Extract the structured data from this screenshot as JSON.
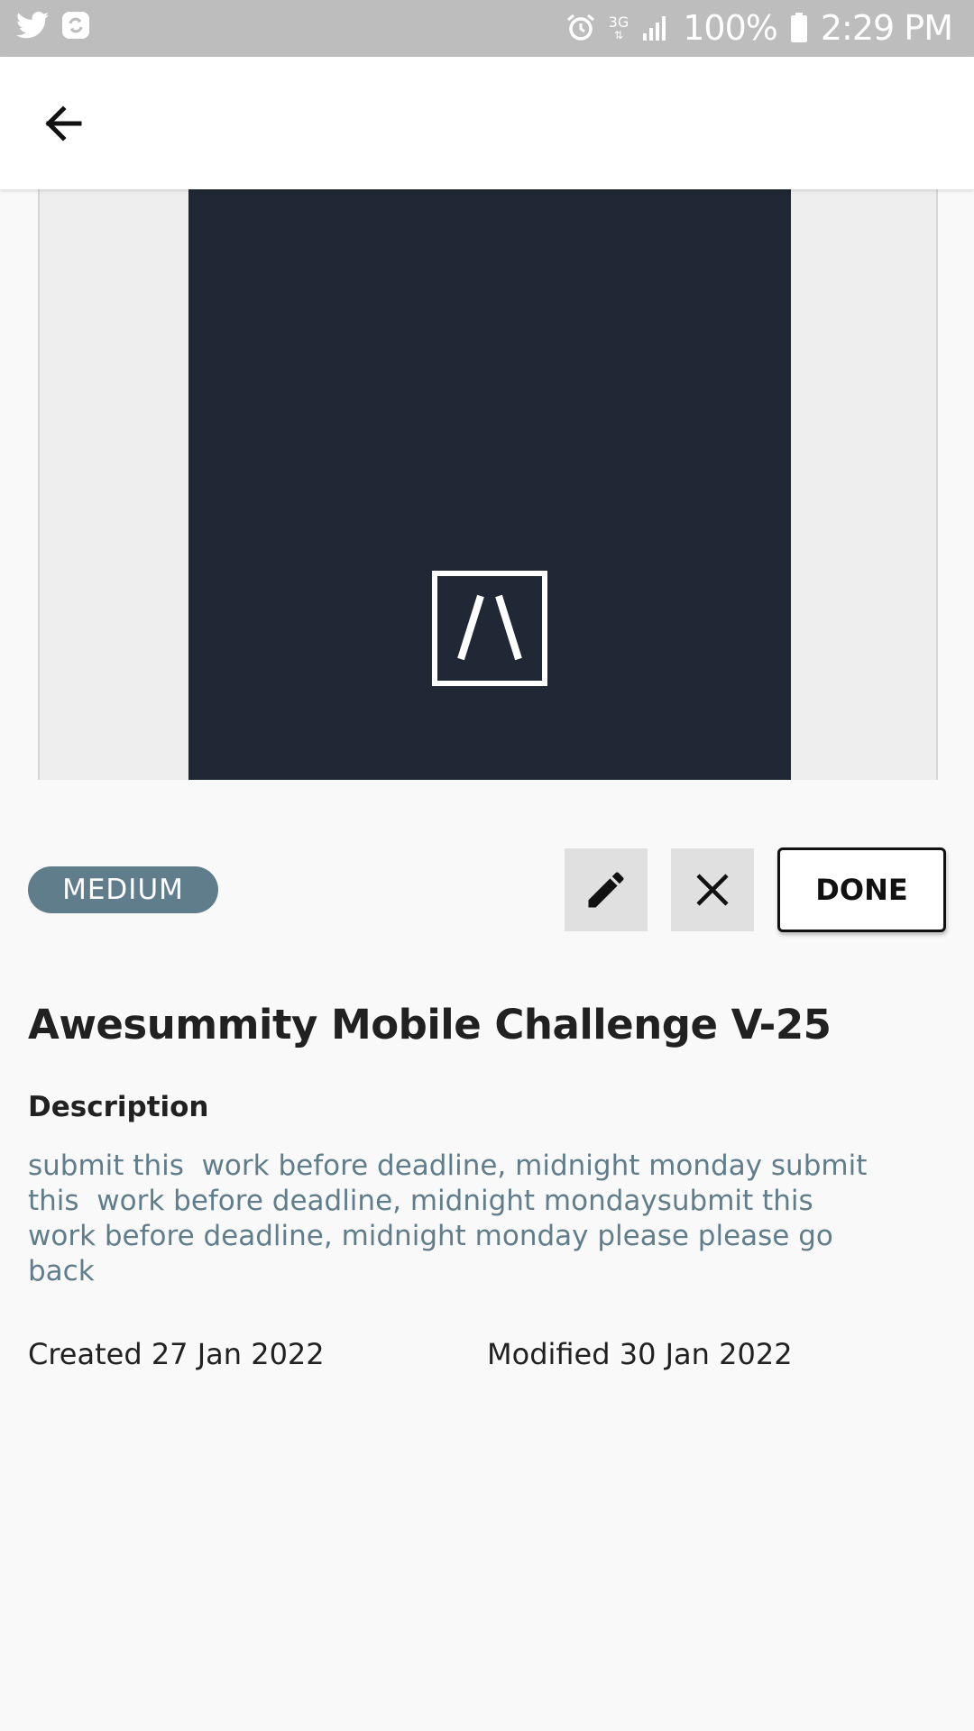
{
  "status_bar": {
    "battery": "100%",
    "time": "2:29 PM",
    "network": "3G",
    "icons": [
      "twitter-icon",
      "sync-icon",
      "alarm-icon",
      "network-3g-icon",
      "signal-icon",
      "battery-icon"
    ]
  },
  "app_bar": {
    "back_icon": "arrow-left-icon"
  },
  "task": {
    "priority": "MEDIUM",
    "title": "Awesummity Mobile Challenge V-25",
    "description_label": "Description",
    "description": "submit this  work before deadline, midnight monday submit\nthis  work before deadline, midnight mondaysubmit this\nwork before deadline, midnight monday please please go\nback",
    "created": "Created 27 Jan 2022",
    "modified": "Modified 30 Jan 2022"
  },
  "actions": {
    "edit_icon": "pencil-icon",
    "close_icon": "close-icon",
    "done_label": "DONE"
  },
  "colors": {
    "status_bar": "#bdbdbd",
    "poster_bg": "#1f2834",
    "badge_bg": "#607d8b",
    "description_text": "#607d8b",
    "page_bg": "#f9f9f9"
  }
}
